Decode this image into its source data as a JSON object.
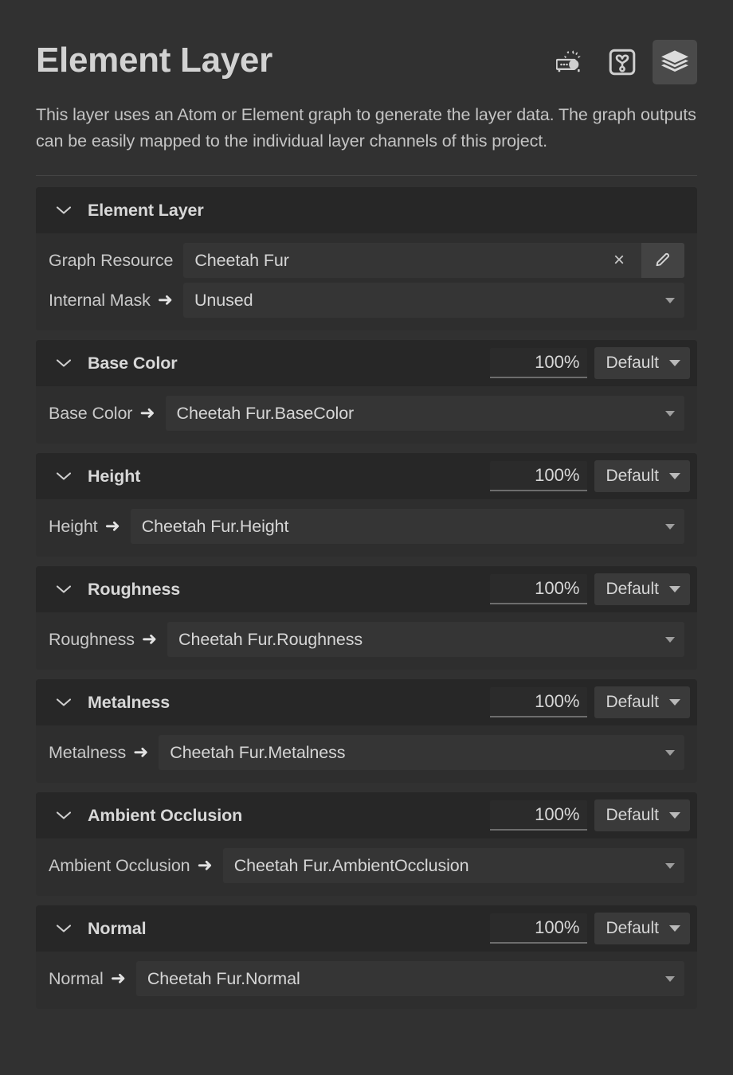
{
  "header": {
    "title": "Element Layer",
    "icons": [
      {
        "name": "projector-icon",
        "label": "projector"
      },
      {
        "name": "material-icon",
        "label": "material"
      },
      {
        "name": "layers-icon",
        "label": "layers",
        "active": true
      }
    ]
  },
  "description": "This layer uses an Atom or Element graph to generate the layer data. The graph outputs can be easily mapped to the individual layer channels of this project.",
  "sections": [
    {
      "title": "Element Layer",
      "collapsed": false,
      "has_opacity": false,
      "rows": [
        {
          "label": "Graph Resource",
          "arrow": false,
          "value": "Cheetah Fur",
          "type": "resource",
          "clear_label": "×"
        },
        {
          "label": "Internal Mask",
          "arrow": "➜",
          "value": "Unused",
          "type": "dropdown"
        }
      ]
    },
    {
      "title": "Base Color",
      "collapsed": false,
      "has_opacity": true,
      "opacity": "100%",
      "blend_mode": "Default",
      "rows": [
        {
          "label": "Base Color",
          "arrow": "➜",
          "value": "Cheetah Fur.BaseColor",
          "type": "dropdown"
        }
      ]
    },
    {
      "title": "Height",
      "collapsed": false,
      "has_opacity": true,
      "opacity": "100%",
      "blend_mode": "Default",
      "rows": [
        {
          "label": "Height",
          "arrow": "➜",
          "value": "Cheetah Fur.Height",
          "type": "dropdown"
        }
      ]
    },
    {
      "title": "Roughness",
      "collapsed": false,
      "has_opacity": true,
      "opacity": "100%",
      "blend_mode": "Default",
      "rows": [
        {
          "label": "Roughness",
          "arrow": "➜",
          "value": "Cheetah Fur.Roughness",
          "type": "dropdown"
        }
      ]
    },
    {
      "title": "Metalness",
      "collapsed": false,
      "has_opacity": true,
      "opacity": "100%",
      "blend_mode": "Default",
      "rows": [
        {
          "label": "Metalness",
          "arrow": "➜",
          "value": "Cheetah Fur.Metalness",
          "type": "dropdown"
        }
      ]
    },
    {
      "title": "Ambient Occlusion",
      "collapsed": false,
      "has_opacity": true,
      "opacity": "100%",
      "blend_mode": "Default",
      "rows": [
        {
          "label": "Ambient Occlusion",
          "arrow": "➜",
          "value": "Cheetah Fur.AmbientOcclusion",
          "type": "dropdown"
        }
      ]
    },
    {
      "title": "Normal",
      "collapsed": false,
      "has_opacity": true,
      "opacity": "100%",
      "blend_mode": "Default",
      "rows": [
        {
          "label": "Normal",
          "arrow": "➜",
          "value": "Cheetah Fur.Normal",
          "type": "dropdown"
        }
      ]
    }
  ],
  "colors": {
    "background": "#313131",
    "section_header": "#272727",
    "section_body": "#2e2e2e",
    "value_field": "#353535",
    "active_icon_bg": "#4a4a4a",
    "text_primary": "#d8d8d8",
    "text_secondary": "#c4c4c4"
  }
}
